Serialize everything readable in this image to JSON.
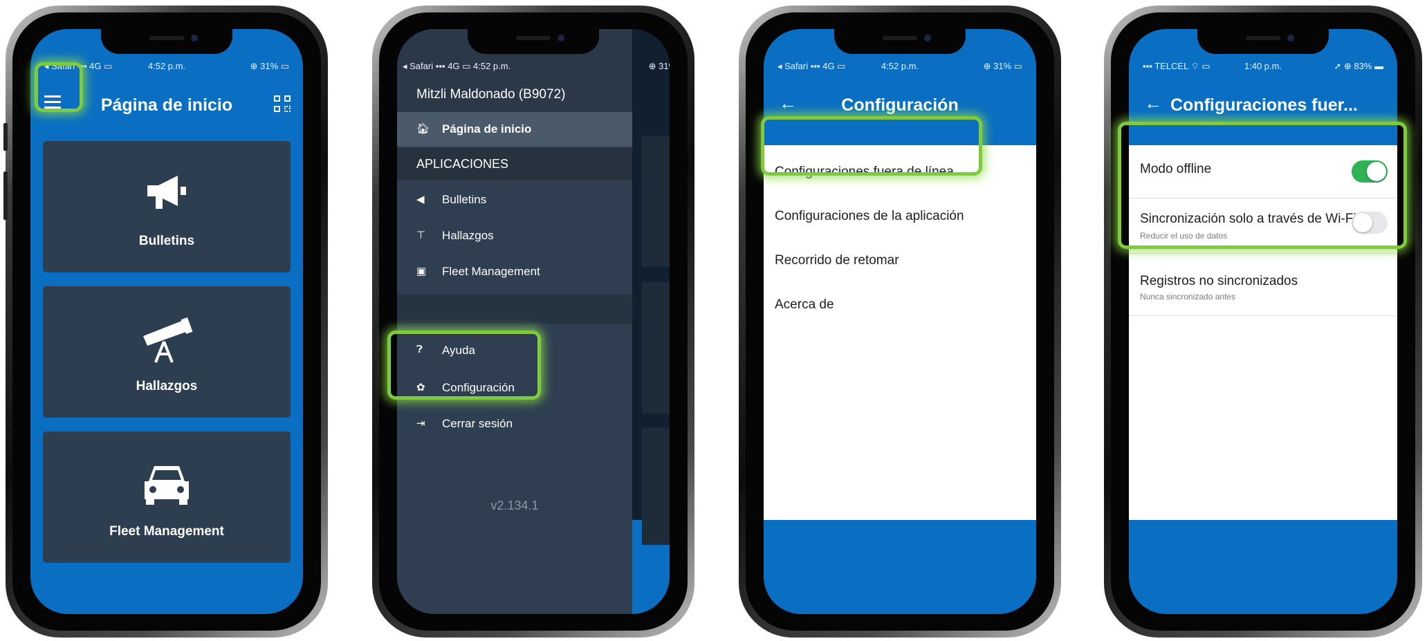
{
  "colors": {
    "app_blue": "#0a6fc2",
    "panel": "#2d3e50",
    "highlight": "#7ecb3e",
    "toggle_on": "#2fb155",
    "toggle_off": "#e5e7ea"
  },
  "phone1": {
    "status": {
      "carrier": "◂ Safari ▪▪▪ 4G ▭",
      "time": "4:52 p.m.",
      "battery": "⊕ 31% ▭"
    },
    "title": "Página de inicio",
    "icons": {
      "menu": "hamburger-menu-icon",
      "qr": "qr-code-icon"
    },
    "cards": [
      {
        "label": "Bulletins",
        "icon": "megaphone-icon"
      },
      {
        "label": "Hallazgos",
        "icon": "telescope-icon"
      },
      {
        "label": "Fleet Management",
        "icon": "car-icon"
      }
    ]
  },
  "phone2": {
    "status": {
      "carrier": "◂ Safari ▪▪▪ 4G ▭",
      "time": "4:52 p.m.",
      "battery": "⊕ 31% ▭"
    },
    "user": "Mitzli Maldonado (B9072)",
    "home": "Página de inicio",
    "section": "APLICACIONES",
    "items": [
      "Bulletins",
      "Hallazgos",
      "Fleet Management"
    ],
    "help": "Ayuda",
    "settings": "Configuración",
    "logout": "Cerrar sesión",
    "version": "v2.134.1"
  },
  "phone3": {
    "status": {
      "carrier": "◂ Safari ▪▪▪ 4G ▭",
      "time": "4:52 p.m.",
      "battery": "⊕ 31% ▭"
    },
    "title": "Configuración",
    "items": [
      "Configuraciones fuera de línea",
      "Configuraciones de la aplicación",
      "Recorrido de retomar",
      "Acerca de"
    ]
  },
  "phone4": {
    "status": {
      "carrier": "▪▪▪ TELCEL ⌔ ▭",
      "time": "1:40 p.m.",
      "battery": "➚ ⊕ 83% ▬"
    },
    "title": "Configuraciones fuer...",
    "offline_label": "Modo offline",
    "offline_on": true,
    "wifi_label": "Sincronización solo a través de Wi-Fi",
    "wifi_sub": "Reducir el uso de datos",
    "wifi_on": false,
    "unsynced_label": "Registros no sincronizados",
    "unsynced_sub": "Nunca sincronizado antes"
  }
}
